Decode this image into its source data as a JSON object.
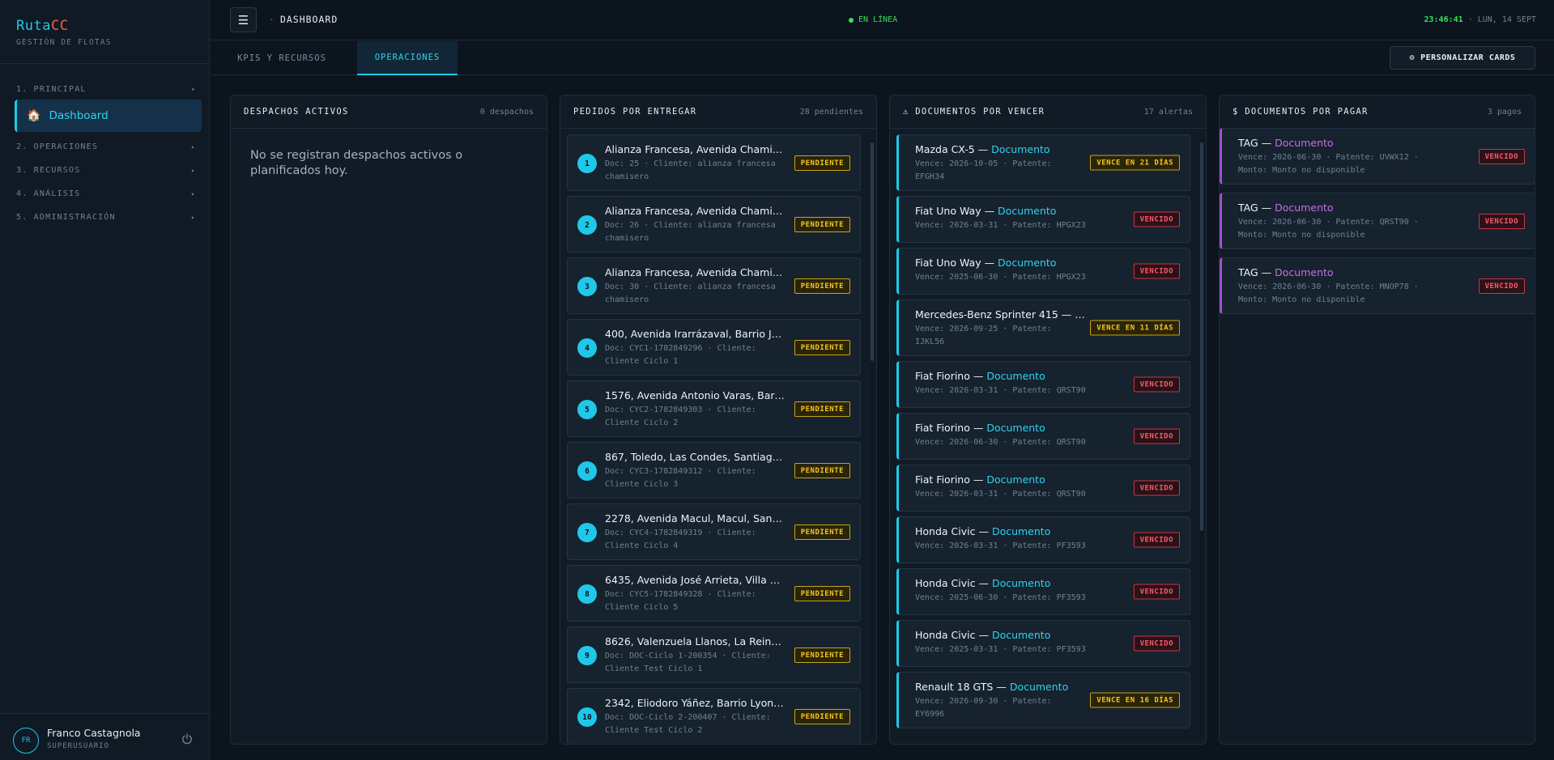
{
  "brand": {
    "name_a": "Ruta",
    "name_b": "CC",
    "subtitle": "GESTIÓN DE FLOTAS"
  },
  "sidebar": {
    "sections": [
      {
        "label": "1. PRINCIPAL",
        "chevron": "▾"
      },
      {
        "label": "2. OPERACIONES",
        "chevron": "▸"
      },
      {
        "label": "3. RECURSOS",
        "chevron": "▸"
      },
      {
        "label": "4. ANÁLISIS",
        "chevron": "▸"
      },
      {
        "label": "5. ADMINISTRACIÓN",
        "chevron": "▸"
      }
    ],
    "active_item": {
      "label": "Dashboard",
      "icon": "home-icon"
    }
  },
  "user": {
    "initials": "FR",
    "name": "Franco Castagnola",
    "role": "SUPERUSUARIO"
  },
  "topbar": {
    "breadcrumb": "DASHBOARD",
    "status": "EN LÍNEA",
    "time": "23:46:41",
    "date": "· LUN, 14 SEPT"
  },
  "tabs": [
    {
      "label": "KPIS Y RECURSOS"
    },
    {
      "label": "OPERACIONES"
    }
  ],
  "customize_label": "PERSONALIZAR CARDS",
  "despachos": {
    "title": "DESPACHOS ACTIVOS",
    "count": "0 despachos",
    "empty": "No se registran despachos activos o planificados hoy."
  },
  "pedidos": {
    "title": "PEDIDOS POR ENTREGAR",
    "count": "28 pendientes",
    "items": [
      {
        "n": "1",
        "title": "Alianza Francesa, Avenida Chamisero, Colina",
        "sub": "Doc: 25 · Cliente: alianza francesa chamisero",
        "badge": "PENDIENTE"
      },
      {
        "n": "2",
        "title": "Alianza Francesa, Avenida Chamisero, Colina",
        "sub": "Doc: 26 · Cliente: alianza francesa chamisero",
        "badge": "PENDIENTE"
      },
      {
        "n": "3",
        "title": "Alianza Francesa, Avenida Chamisero, Colina",
        "sub": "Doc: 30 · Cliente: alianza francesa chamisero",
        "badge": "PENDIENTE"
      },
      {
        "n": "4",
        "title": "400, Avenida Irarrázaval, Barrio Javiera Carrera",
        "sub": "Doc: CYC1-1782849296 · Cliente: Cliente Ciclo 1",
        "badge": "PENDIENTE"
      },
      {
        "n": "5",
        "title": "1576, Avenida Antonio Varas, Barrio Italia",
        "sub": "Doc: CYC2-1782849303 · Cliente: Cliente Ciclo 2",
        "badge": "PENDIENTE"
      },
      {
        "n": "6",
        "title": "867, Toledo, Las Condes, Santiago, Chile",
        "sub": "Doc: CYC3-1782849312 · Cliente: Cliente Ciclo 3",
        "badge": "PENDIENTE"
      },
      {
        "n": "7",
        "title": "2278, Avenida Macul, Macul, Santiago, Chile",
        "sub": "Doc: CYC4-1782849319 · Cliente: Cliente Ciclo 4",
        "badge": "PENDIENTE"
      },
      {
        "n": "8",
        "title": "6435, Avenida José Arrieta, Villa Los Presidentes",
        "sub": "Doc: CYC5-1782849328 · Cliente: Cliente Ciclo 5",
        "badge": "PENDIENTE"
      },
      {
        "n": "9",
        "title": "8626, Valenzuela Llanos, La Reina, Santiago",
        "sub": "Doc: DOC-Ciclo 1-200354 · Cliente: Cliente Test Ciclo 1",
        "badge": "PENDIENTE"
      },
      {
        "n": "10",
        "title": "2342, Eliodoro Yáñez, Barrio Lyon, Providencia",
        "sub": "Doc: DOC-Ciclo 2-200407 · Cliente: Cliente Test Ciclo 2",
        "badge": "PENDIENTE"
      }
    ]
  },
  "docs_vencer": {
    "title": "DOCUMENTOS POR VENCER",
    "count": "17 alertas",
    "warn_icon": "⚠",
    "items": [
      {
        "vehicle": "Mazda CX-5 — ",
        "doc": "Documento",
        "sub": "Vence: 2026-10-05 · Patente: EFGH34",
        "badge": "VENCE EN 21 DÍAS",
        "kind": "warn",
        "h": "h70"
      },
      {
        "vehicle": "Fiat Uno Way — ",
        "doc": "Documento",
        "sub": "Vence: 2026-03-31 · Patente: HPGX23",
        "badge": "VENCIDO",
        "kind": "exp",
        "h": "h58"
      },
      {
        "vehicle": "Fiat Uno Way — ",
        "doc": "Documento",
        "sub": "Vence: 2025-06-30 · Patente: HPGX23",
        "badge": "VENCIDO",
        "kind": "exp",
        "h": "h58"
      },
      {
        "vehicle": "Mercedes-Benz Sprinter 415 — ",
        "doc": "Documento",
        "sub": "Vence: 2026-09-25 · Patente: IJKL56",
        "badge": "VENCE EN 11 DÍAS",
        "kind": "warn",
        "h": "h70"
      },
      {
        "vehicle": "Fiat Fiorino — ",
        "doc": "Documento",
        "sub": "Vence: 2026-03-31 · Patente: QRST90",
        "badge": "VENCIDO",
        "kind": "exp",
        "h": "h58"
      },
      {
        "vehicle": "Fiat Fiorino — ",
        "doc": "Documento",
        "sub": "Vence: 2026-06-30 · Patente: QRST90",
        "badge": "VENCIDO",
        "kind": "exp",
        "h": "h58"
      },
      {
        "vehicle": "Fiat Fiorino — ",
        "doc": "Documento",
        "sub": "Vence: 2026-03-31 · Patente: QRST90",
        "badge": "VENCIDO",
        "kind": "exp",
        "h": "h58"
      },
      {
        "vehicle": "Honda Civic — ",
        "doc": "Documento",
        "sub": "Vence: 2026-03-31 · Patente: PF3593",
        "badge": "VENCIDO",
        "kind": "exp",
        "h": "h58"
      },
      {
        "vehicle": "Honda Civic — ",
        "doc": "Documento",
        "sub": "Vence: 2025-06-30 · Patente: PF3593",
        "badge": "VENCIDO",
        "kind": "exp",
        "h": "h58"
      },
      {
        "vehicle": "Honda Civic — ",
        "doc": "Documento",
        "sub": "Vence: 2025-03-31 · Patente: PF3593",
        "badge": "VENCIDO",
        "kind": "exp",
        "h": "h58"
      },
      {
        "vehicle": "Renault 18 GTS — ",
        "doc": "Documento",
        "sub": "Vence: 2026-09-30 · Patente: EY6996",
        "badge": "VENCE EN 16 DÍAS",
        "kind": "warn",
        "h": "h70"
      }
    ]
  },
  "docs_pagar": {
    "title": "DOCUMENTOS POR PAGAR",
    "count": "3 pagos",
    "icon": "$",
    "items": [
      {
        "vehicle": "TAG — ",
        "doc": "Documento",
        "sub": "Vence: 2026-06-30 · Patente: UVWX12 · Monto: Monto no disponible",
        "badge": "VENCIDO"
      },
      {
        "vehicle": "TAG — ",
        "doc": "Documento",
        "sub": "Vence: 2026-06-30 · Patente: QRST90 · Monto: Monto no disponible",
        "badge": "VENCIDO"
      },
      {
        "vehicle": "TAG — ",
        "doc": "Documento",
        "sub": "Vence: 2026-06-30 · Patente: MNOP78 · Monto: Monto no disponible",
        "badge": "VENCIDO"
      }
    ]
  }
}
